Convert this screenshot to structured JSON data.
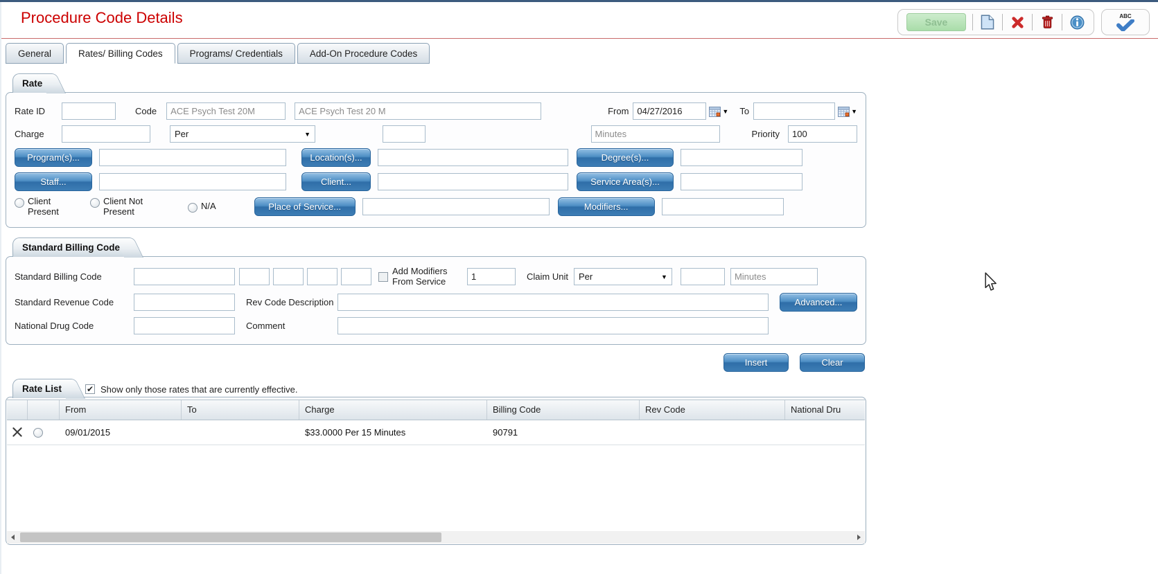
{
  "window": {
    "title": "Procedure Code Details"
  },
  "toolbar": {
    "save": "Save"
  },
  "icons": {
    "new_document": "new-document-icon",
    "cancel": "cancel-icon",
    "delete": "delete-icon",
    "info": "info-icon",
    "spellcheck": "spellcheck-icon",
    "spellcheck_label": "ABC",
    "calendar": "calendar-icon"
  },
  "tabs": [
    {
      "label": "General",
      "active": false
    },
    {
      "label": "Rates/ Billing Codes",
      "active": true
    },
    {
      "label": "Programs/ Credentials",
      "active": false
    },
    {
      "label": "Add-On Procedure Codes",
      "active": false
    }
  ],
  "rate": {
    "header": "Rate",
    "rate_id_label": "Rate ID",
    "rate_id_value": "",
    "code_label": "Code",
    "code_short": "ACE Psych Test 20M",
    "code_full": "ACE Psych Test 20 M",
    "from_label": "From",
    "from_value": "04/27/2016",
    "to_label": "To",
    "to_value": "",
    "charge_label": "Charge",
    "charge_value": "",
    "per_value": "Per",
    "unit_value": "",
    "minutes_value": "Minutes",
    "priority_label": "Priority",
    "priority_value": "100",
    "buttons": {
      "programs": "Program(s)...",
      "locations": "Location(s)...",
      "degrees": "Degree(s)...",
      "staff": "Staff...",
      "client": "Client...",
      "service_areas": "Service Area(s)...",
      "place_of_service": "Place of Service...",
      "modifiers": "Modifiers..."
    },
    "radios": [
      {
        "label": "Client Present",
        "selected": false
      },
      {
        "label": "Client Not Present",
        "selected": false
      },
      {
        "label": "N/A",
        "selected": true
      }
    ]
  },
  "standard_billing": {
    "header": "Standard Billing Code",
    "sbc_label": "Standard Billing Code",
    "sbc_value": "",
    "add_modifiers_label": "Add Modifiers From Service",
    "add_modifiers_checked": false,
    "unit_value": "1",
    "claim_unit_label": "Claim Unit",
    "claim_unit_per": "Per",
    "claim_small_value": "",
    "claim_minutes": "Minutes",
    "src_label": "Standard Revenue Code",
    "src_value": "",
    "rev_desc_label": "Rev Code Description",
    "rev_desc_value": "",
    "advanced": "Advanced...",
    "ndc_label": "National Drug Code",
    "ndc_value": "",
    "comment_label": "Comment",
    "comment_value": ""
  },
  "actions": {
    "insert": "Insert",
    "clear": "Clear"
  },
  "rate_list": {
    "header": "Rate List",
    "filter_label": "Show only those rates that are currently effective.",
    "filter_checked": true,
    "columns": [
      "From",
      "To",
      "Charge",
      "Billing Code",
      "Rev Code",
      "National Dru"
    ],
    "rows": [
      {
        "from": "09/01/2015",
        "to": "",
        "charge": "$33.0000 Per 15 Minutes",
        "billing_code": "90791",
        "rev_code": "",
        "national_drug": ""
      }
    ]
  }
}
